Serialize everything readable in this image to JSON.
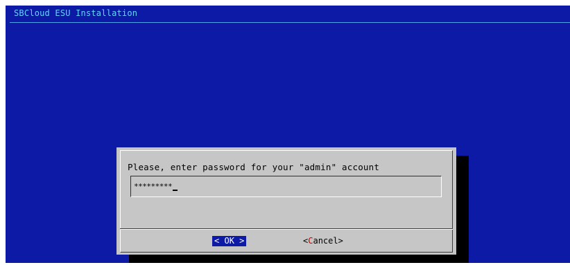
{
  "screen": {
    "backtitle": "SBCloud ESU Installation"
  },
  "dialog": {
    "prompt": "Please, enter password for your \"admin\" account",
    "password_value": "*********",
    "buttons": {
      "ok": {
        "left_bracket": "<",
        "hotkey": "O",
        "rest": "K",
        "right_bracket": ">"
      },
      "cancel": {
        "left_bracket": "<",
        "hotkey": "C",
        "rest": "ancel",
        "right_bracket": ">"
      }
    }
  },
  "colors": {
    "screen_background": "#0c1aa6",
    "dialog_background": "#c6c6c6",
    "backtitle_text": "#66d2ff",
    "hotkey": "#c80000",
    "selected_button_background": "#0c1aa6"
  }
}
